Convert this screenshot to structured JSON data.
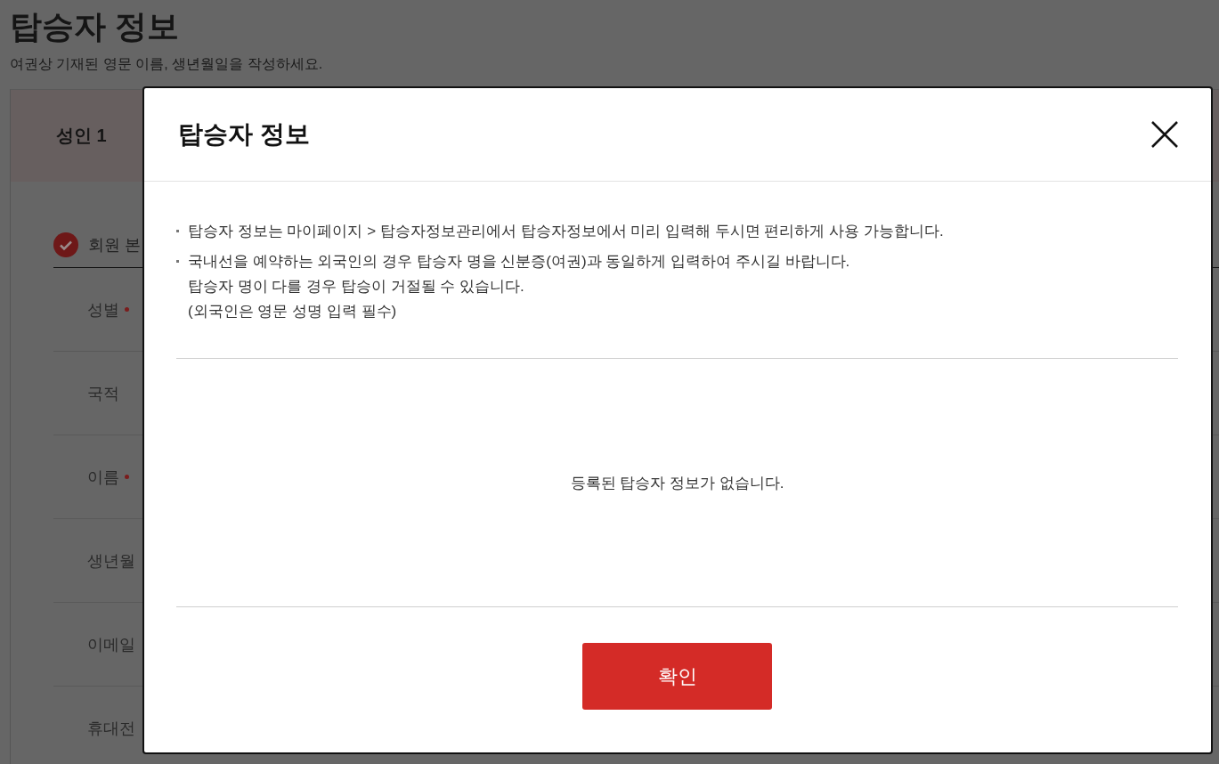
{
  "page": {
    "title": "탑승자 정보",
    "subtitle": "여권상 기재된 영문 이름, 생년월일을 작성하세요.",
    "passenger_tab": "성인 1",
    "member_option": {
      "label": "회원 본",
      "checked": true
    },
    "fields": [
      {
        "label": "성별",
        "required": true
      },
      {
        "label": "국적",
        "required": false
      },
      {
        "label": "이름",
        "required": true
      },
      {
        "label": "생년월",
        "required": false
      },
      {
        "label": "이메일",
        "required": false
      },
      {
        "label": "휴대전",
        "required": false
      }
    ]
  },
  "modal": {
    "title": "탑승자 정보",
    "notes": [
      "탑승자 정보는 마이페이지 > 탑승자정보관리에서 탑승자정보에서 미리 입력해 두시면 편리하게 사용 가능합니다.",
      "국내선을 예약하는 외국인의 경우 탑승자 명을 신분증(여권)과 동일하게 입력하여 주시길 바랍니다.\n탑승자 명이 다를 경우 탑승이 거절될 수 있습니다.\n(외국인은 영문 성명 입력 필수)"
    ],
    "empty_message": "등록된 탑승자 정보가 없습니다.",
    "confirm_button": "확인"
  }
}
